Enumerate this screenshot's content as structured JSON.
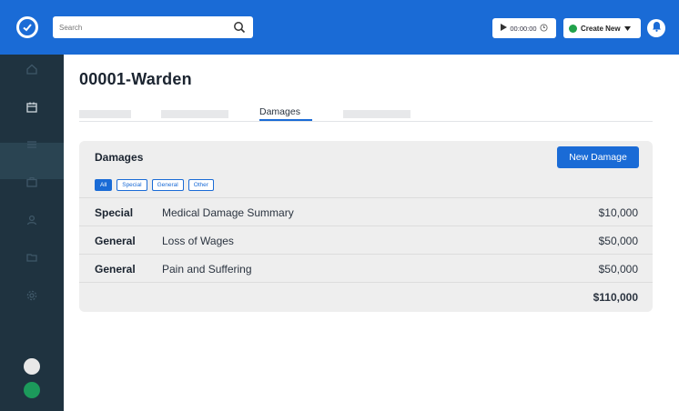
{
  "topbar": {
    "search_placeholder": "Search",
    "timer": "00:00:00",
    "create_label": "Create New"
  },
  "page": {
    "title": "00001-Warden"
  },
  "tabs": {
    "active_label": "Damages"
  },
  "card": {
    "title": "Damages",
    "new_button": "New Damage",
    "filters": [
      "All",
      "Special",
      "General",
      "Other"
    ],
    "rows": [
      {
        "type": "Special",
        "description": "Medical Damage Summary",
        "amount": "$10,000"
      },
      {
        "type": "General",
        "description": "Loss of Wages",
        "amount": "$50,000"
      },
      {
        "type": "General",
        "description": "Pain and Suffering",
        "amount": "$50,000"
      }
    ],
    "total": "$110,000"
  },
  "colors": {
    "brand": "#1a6bd6",
    "sidebar": "#1f3340",
    "card_bg": "#eeeeee",
    "status_green": "#21a24b"
  },
  "icons": [
    "check-circle-icon",
    "search-icon",
    "play-icon",
    "clock-icon",
    "plus-circle-icon",
    "caret-down-icon",
    "bell-icon",
    "home-icon",
    "calendar-icon",
    "list-icon",
    "briefcase-icon",
    "user-icon",
    "folder-icon",
    "gear-icon"
  ]
}
